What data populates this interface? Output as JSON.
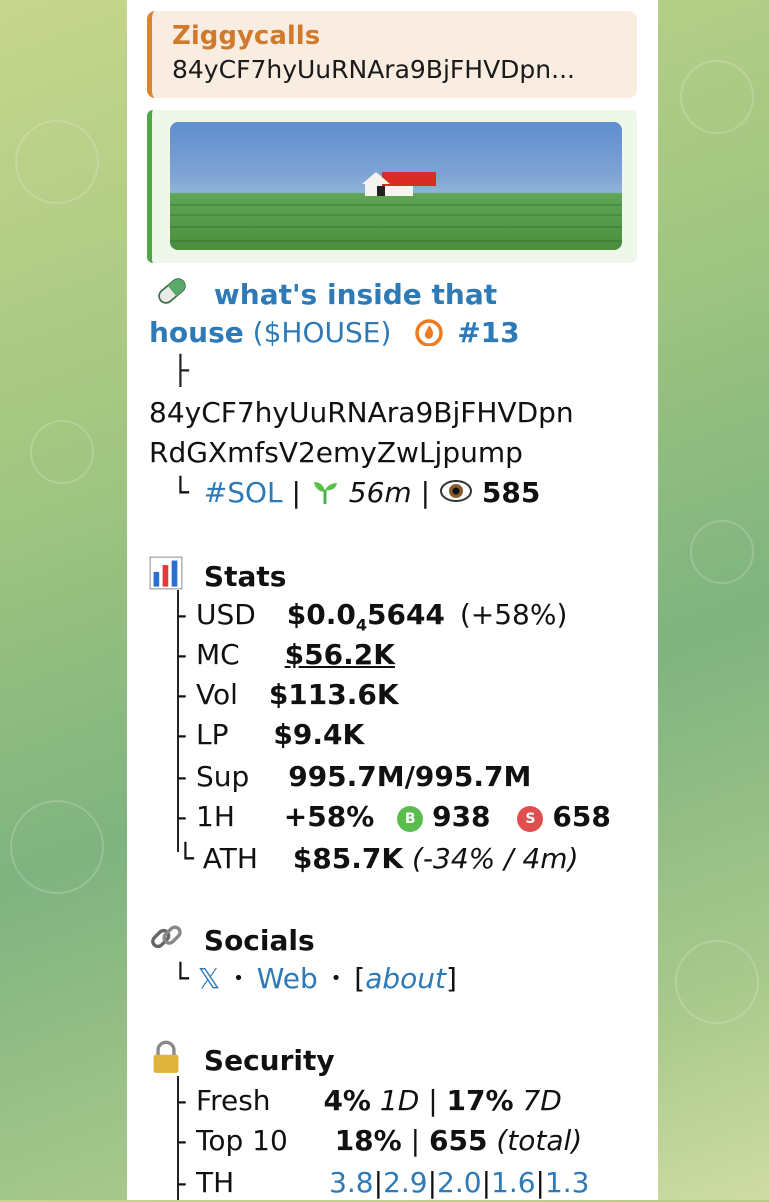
{
  "reply": {
    "name": "Ziggycalls",
    "text": "84yCF7hyUuRNAra9BjFHVDpn..."
  },
  "token": {
    "title_line1": "what's inside that",
    "title_line2": "house",
    "ticker": "($HOUSE)",
    "rank": "#13",
    "address_line1": "84yCF7hyUuRNAra9BjFHVDpn",
    "address_line2": "RdGXmfsV2emyZwLjpump",
    "chain": "#SOL",
    "age": "56m",
    "views": "585"
  },
  "stats": {
    "heading": "Stats",
    "rows": [
      {
        "label": "USD",
        "value_main": "$0.0",
        "value_sub": "4",
        "value_tail": "5644",
        "extra": "(+58%)"
      },
      {
        "label": "MC",
        "value": "$56.2K"
      },
      {
        "label": "Vol",
        "value": "$113.6K"
      },
      {
        "label": "LP",
        "value": "$9.4K"
      },
      {
        "label": "Sup",
        "value": "995.7M/995.7M"
      },
      {
        "label": "1H",
        "value": "+58%",
        "buy_badge": "B",
        "buys": "938",
        "sell_badge": "S",
        "sells": "658"
      },
      {
        "label": "ATH",
        "value": "$85.7K",
        "extra": "(-34% / 4m)"
      }
    ]
  },
  "socials": {
    "heading": "Socials",
    "x": "𝕏",
    "web": "Web",
    "about": "about",
    "sep": "•"
  },
  "security": {
    "heading": "Security",
    "fresh_label": "Fresh",
    "fresh_a": "4%",
    "fresh_a_period": "1D",
    "fresh_b": "17%",
    "fresh_b_period": "7D",
    "top10_label": "Top 10",
    "top10_value": "18%",
    "top10_total": "655",
    "top10_total_label": "(total)",
    "th_label": "TH",
    "th_values": [
      "3.8",
      "2.9",
      "2.0",
      "1.6",
      "1.3"
    ]
  },
  "colors": {
    "link": "#2e7ab6",
    "reply_accent": "#d9842e",
    "preview_accent": "#4ea645",
    "buy": "#5bbd4e",
    "sell": "#e04f4f"
  }
}
